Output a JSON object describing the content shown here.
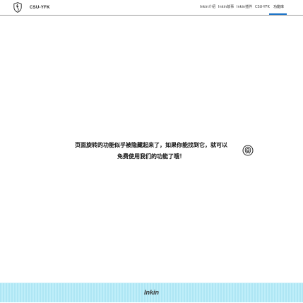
{
  "header": {
    "brand": "CSU-YFK",
    "nav": [
      {
        "label": "Inkin介绍"
      },
      {
        "label": "Inkin故事"
      },
      {
        "label": "Inkin插件"
      },
      {
        "label": "CSU-YFK"
      },
      {
        "label": "功能库"
      }
    ],
    "active_index": 4,
    "icons": {
      "logo": "shield-logo-icon"
    }
  },
  "main": {
    "message": "页面旋转的功能似乎被隐藏起来了，如果你能找到它，就可以免费使用我们的功能了哦！",
    "action_icon": "fingerprint-icon"
  },
  "footer": {
    "text": "Inkin"
  },
  "colors": {
    "accent": "#1a73c8",
    "footer_bg": "#aee6f4",
    "text": "#111111",
    "divider": "#9a9a9a"
  }
}
